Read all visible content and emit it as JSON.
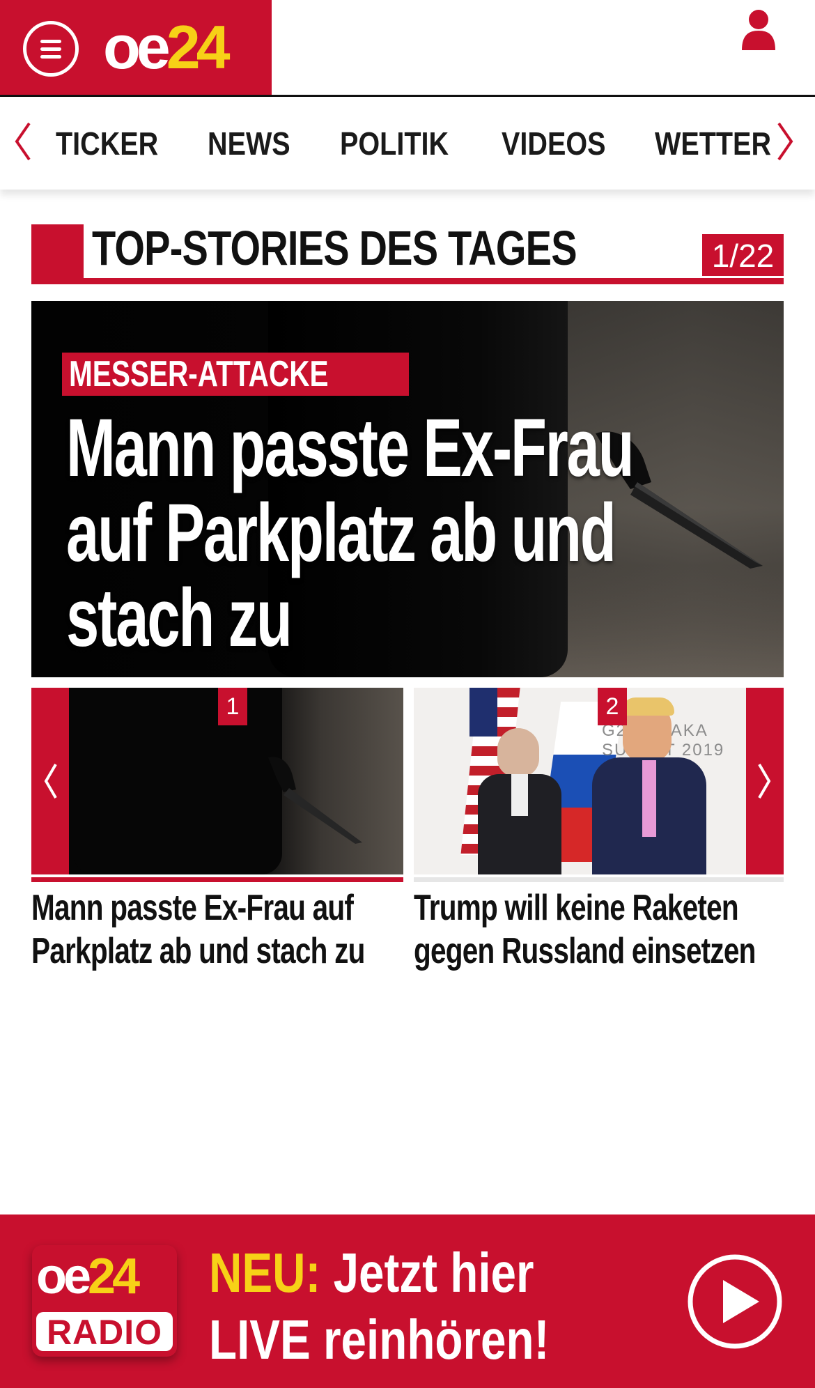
{
  "brand": {
    "logo_oe": "oe",
    "logo_24": "24",
    "red": "#c8102e",
    "yellow": "#f7d117"
  },
  "nav": {
    "items": [
      "TICKER",
      "NEWS",
      "POLITIK",
      "VIDEOS",
      "WETTER"
    ],
    "prev_icon": "chevron-left-icon",
    "next_icon": "chevron-right-icon"
  },
  "section": {
    "title": "TOP-STORIES DES TAGES",
    "counter": "1/22"
  },
  "hero": {
    "kicker": "MESSER-ATTACKE",
    "title": "Mann passte Ex-Frau auf Parkplatz ab und stach zu"
  },
  "stories": [
    {
      "badge": "1",
      "title": "Mann passte Ex-Frau auf Parkplatz ab und stach zu"
    },
    {
      "badge": "2",
      "title": "Trump will keine Raketen gegen Russland einsetzen",
      "image_text": "G20 OSAKA SUMMIT 2019"
    }
  ],
  "radio": {
    "logo_oe": "oe",
    "logo_24": "24",
    "logo_label": "RADIO",
    "line1_highlight": "NEU:",
    "line1_rest": " Jetzt hier",
    "line2": "LIVE reinhören!"
  }
}
